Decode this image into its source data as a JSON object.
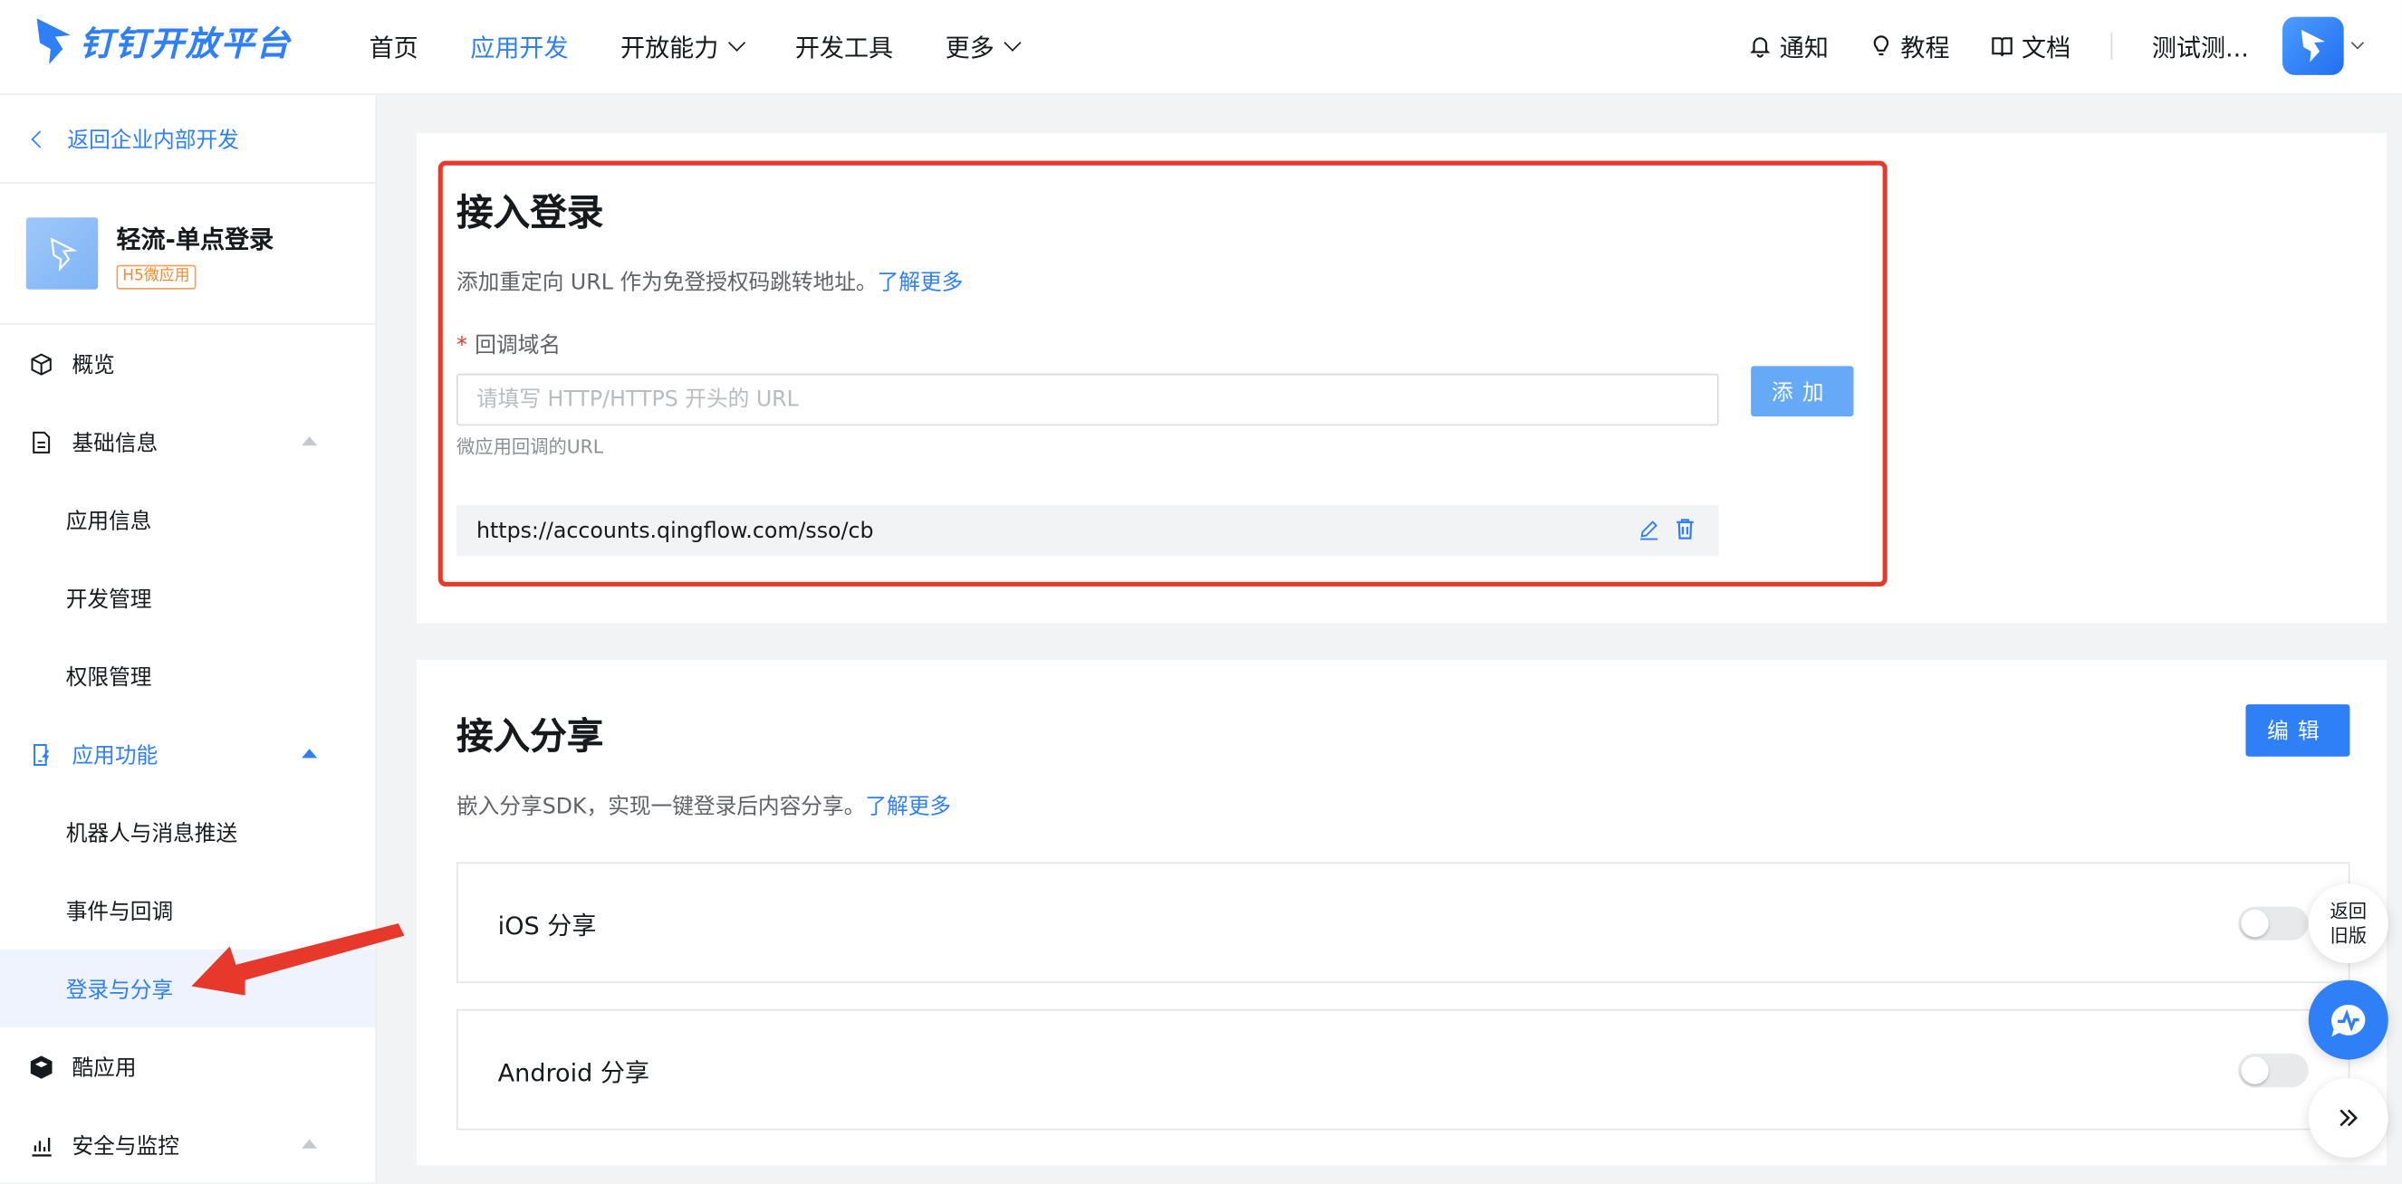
{
  "brand": {
    "logo_text": "钉钉开放平台"
  },
  "nav": {
    "items": [
      {
        "label": "首页"
      },
      {
        "label": "应用开发"
      },
      {
        "label": "开放能力"
      },
      {
        "label": "开发工具"
      },
      {
        "label": "更多"
      }
    ],
    "active": "应用开发"
  },
  "header_right": {
    "notify": "通知",
    "tutorial": "教程",
    "docs": "文档",
    "user_name": "测试测..."
  },
  "sidebar": {
    "back_label": "返回企业内部开发",
    "app": {
      "name": "轻流-单点登录",
      "tag": "H5微应用"
    },
    "menu": {
      "overview": "概览",
      "basic_info": "基础信息",
      "app_info": "应用信息",
      "dev_manage": "开发管理",
      "permission": "权限管理",
      "app_features": "应用功能",
      "robot_push": "机器人与消息推送",
      "events": "事件与回调",
      "login_share": "登录与分享",
      "cool_app": "酷应用",
      "security": "安全与监控"
    }
  },
  "login_section": {
    "title": "接入登录",
    "description": "添加重定向 URL 作为免登授权码跳转地址。",
    "learn_more": "了解更多",
    "field_label": "回调域名",
    "input_placeholder": "请填写 HTTP/HTTPS 开头的 URL",
    "hint": "微应用回调的URL",
    "add_button": "添加",
    "urls": [
      "https://accounts.qingflow.com/sso/cb"
    ]
  },
  "share_section": {
    "title": "接入分享",
    "description": "嵌入分享SDK，实现一键登录后内容分享。",
    "learn_more": "了解更多",
    "edit_button": "编辑",
    "ios_label": "iOS 分享",
    "ios_enabled": false,
    "android_label": "Android 分享",
    "android_enabled": false
  },
  "floating": {
    "back_old_line1": "返回",
    "back_old_line2": "旧版"
  },
  "colors": {
    "accent": "#2f7ff7",
    "highlight_border": "#e6392b",
    "tag": "#f28b2e"
  }
}
